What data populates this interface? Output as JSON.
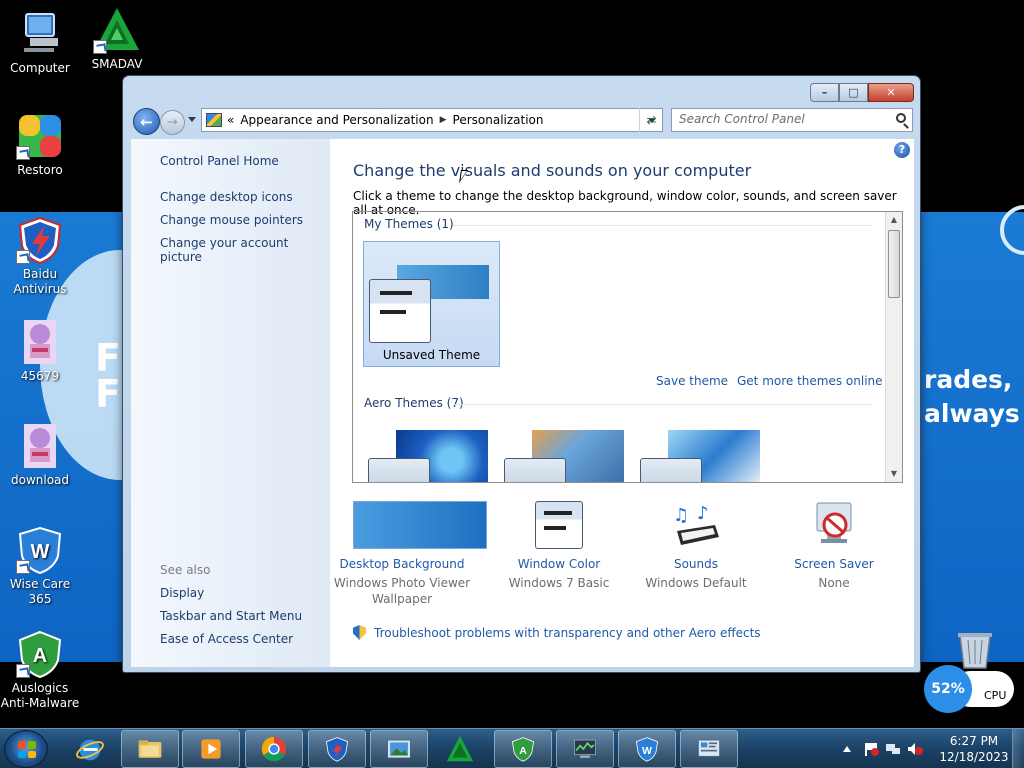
{
  "desktop": {
    "wallpaper": {
      "left_text": "FO\nF",
      "right_text": "rades,\nalways"
    },
    "icons": [
      {
        "label": "Computer"
      },
      {
        "label": "SMADAV"
      },
      {
        "label": "Restoro"
      },
      {
        "label": "Baidu\nAntivirus"
      },
      {
        "label": "45679"
      },
      {
        "label": "download"
      },
      {
        "label": "Wise Care 365"
      },
      {
        "label": "Auslogics\nAnti-Malware"
      }
    ]
  },
  "window": {
    "title_buttons": {
      "minimize": "–",
      "maximize": "□",
      "close": "✕"
    },
    "address": {
      "prefix": "«",
      "crumbs": [
        "Appearance and Personalization",
        "Personalization"
      ]
    },
    "search": {
      "placeholder": "Search Control Panel"
    },
    "left_pane": {
      "home": "Control Panel Home",
      "links": [
        "Change desktop icons",
        "Change mouse pointers",
        "Change your account picture"
      ],
      "see_also": "See also",
      "see_also_links": [
        "Display",
        "Taskbar and Start Menu",
        "Ease of Access Center"
      ]
    },
    "main": {
      "heading": "Change the visuals and sounds on your computer",
      "subheading": "Click a theme to change the desktop background, window color, sounds, and screen saver all at once.",
      "my_themes_label": "My Themes (1)",
      "unsaved_theme": "Unsaved Theme",
      "save_theme": "Save theme",
      "get_more": "Get more themes online",
      "aero_themes_label": "Aero Themes (7)",
      "options": [
        {
          "name": "Desktop Background",
          "value": "Windows Photo Viewer Wallpaper"
        },
        {
          "name": "Window Color",
          "value": "Windows 7 Basic"
        },
        {
          "name": "Sounds",
          "value": "Windows Default"
        },
        {
          "name": "Screen Saver",
          "value": "None"
        }
      ],
      "troubleshoot": "Troubleshoot problems with transparency and other Aero effects"
    }
  },
  "cpu_widget": {
    "percent": "52%",
    "label": "CPU"
  },
  "taskbar": {
    "apps": [
      "internet-explorer",
      "file-explorer",
      "media-player",
      "chrome",
      "baidu-antivirus",
      "photo-viewer",
      "smadav",
      "auslogics",
      "system-monitor",
      "wise-care",
      "control-panel"
    ],
    "clock": {
      "time": "6:27 PM",
      "date": "12/18/2023"
    }
  },
  "colors": {
    "link": "#1e5aa8",
    "heading": "#1e3c6e",
    "taskbar": "#1b4266",
    "cpu_accent": "#2c8ee6"
  }
}
